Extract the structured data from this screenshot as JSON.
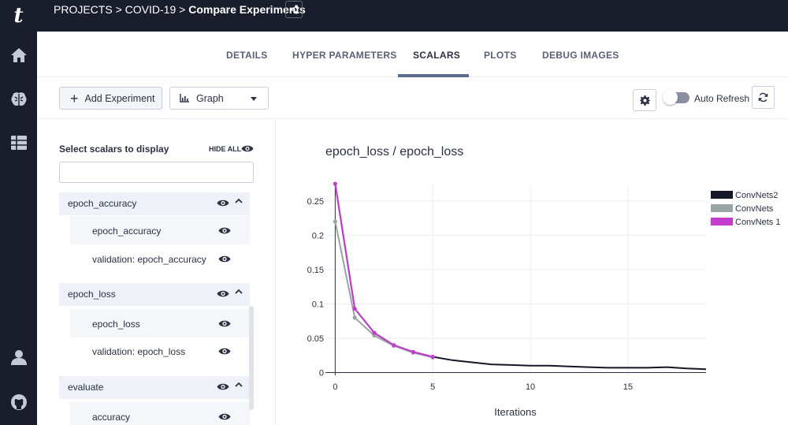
{
  "header": {
    "crumb_projects": "PROJECTS",
    "crumb_sep1": " > ",
    "crumb_project": "COVID-19",
    "crumb_sep2": " > ",
    "crumb_page": "Compare Experiments",
    "logo_letter": "t"
  },
  "rail": {
    "icons": [
      "home-icon",
      "brain-icon",
      "table-icon",
      "user-icon",
      "github-icon"
    ]
  },
  "tabs": [
    {
      "label": "DETAILS"
    },
    {
      "label": "HYPER PARAMETERS"
    },
    {
      "label": "SCALARS",
      "active": true
    },
    {
      "label": "PLOTS"
    },
    {
      "label": "DEBUG IMAGES"
    }
  ],
  "toolbar": {
    "add_experiment": "Add Experiment",
    "view_select": "Graph",
    "auto_refresh": "Auto Refresh",
    "auto_refresh_on": false
  },
  "panel": {
    "title": "Select scalars to display",
    "hide_all": "HIDE ALL",
    "filter_placeholder": "",
    "groups": [
      {
        "label": "epoch_accuracy",
        "items": [
          "epoch_accuracy",
          "validation: epoch_accuracy"
        ]
      },
      {
        "label": "epoch_loss",
        "items": [
          "epoch_loss",
          "validation: epoch_loss"
        ]
      },
      {
        "label": "evaluate",
        "items": [
          "accuracy"
        ]
      }
    ]
  },
  "colors": {
    "navy": "#1a1e2c",
    "accent": "#5a6b8c",
    "convnets2": "#141826",
    "convnets": "#9aa3a5",
    "convnets1": "#c33ecf"
  },
  "chart_data": {
    "type": "line",
    "title": "epoch_loss / epoch_loss",
    "xlabel": "Iterations",
    "ylabel": "",
    "xlim": [
      -0.5,
      19
    ],
    "ylim": [
      -0.004,
      0.29
    ],
    "xticks": [
      0,
      5,
      10,
      15
    ],
    "yticks": [
      0,
      0.05,
      0.1,
      0.15,
      0.2,
      0.25
    ],
    "ytick_labels": [
      "0",
      "0.05",
      "0.1",
      "0.15",
      "0.2",
      "0.25"
    ],
    "grid": true,
    "legend_position": "top-right",
    "series": [
      {
        "name": "ConvNets2",
        "color": "#141826",
        "markers": false,
        "x": [
          0,
          1,
          2,
          3,
          4,
          5,
          6,
          7,
          8,
          9,
          10,
          11,
          12,
          13,
          14,
          15,
          16,
          17,
          18,
          19
        ],
        "y": [
          0.275,
          0.093,
          0.058,
          0.04,
          0.03,
          0.023,
          0.018,
          0.015,
          0.012,
          0.011,
          0.01,
          0.01,
          0.009,
          0.008,
          0.007,
          0.007,
          0.007,
          0.008,
          0.006,
          0.005
        ]
      },
      {
        "name": "ConvNets",
        "color": "#9aa3a5",
        "markers": true,
        "x": [
          0,
          1,
          2,
          3,
          4,
          5
        ],
        "y": [
          0.22,
          0.08,
          0.054,
          0.039,
          0.029,
          0.022
        ]
      },
      {
        "name": "ConvNets 1",
        "color": "#c33ecf",
        "markers": true,
        "x": [
          0,
          1,
          2,
          3,
          4,
          5
        ],
        "y": [
          0.275,
          0.093,
          0.058,
          0.04,
          0.03,
          0.023
        ]
      }
    ]
  }
}
